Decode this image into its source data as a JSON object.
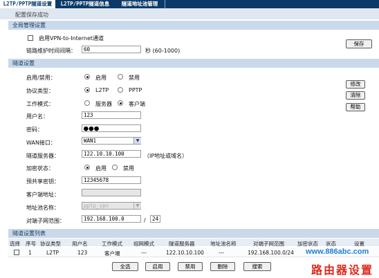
{
  "tabs": [
    "L2TP/PPTP隧道设置",
    "L2TP/PPTP隧道信息",
    "隧道地址池管理"
  ],
  "banner": "配置保存成功",
  "global": {
    "title": "全局管理设置",
    "enable_vpn_label": "启用VPN-to-Internet通道",
    "keepalive_label": "链路维护时间间隔：",
    "keepalive_value": "60",
    "keepalive_unit": "秒 (60-1000)",
    "save_label": "保存"
  },
  "tunnel": {
    "title": "隧道设置",
    "enable_label": "启用/禁用：",
    "opt_enable": "启用",
    "opt_disable": "禁用",
    "protocol_label": "协议类型：",
    "opt_l2tp": "L2TP",
    "opt_pptp": "PPTP",
    "mode_label": "工作模式：",
    "opt_server": "服务器",
    "opt_client": "客户端",
    "username_label": "用户名：",
    "username_value": "123",
    "password_label": "密码：",
    "password_value": "●●●",
    "wan_label": "WAN接口：",
    "wan_value": "WAN1",
    "server_label": "隧道服务器：",
    "server_value": "122.10.10.100",
    "server_hint": "（IP地址或域名）",
    "encrypt_label": "加密状态：",
    "opt_encrypt_on": "启用",
    "opt_encrypt_off": "禁用",
    "psk_label": "预共享密钥：",
    "psk_value": "12345678",
    "client_addr_label": "客户端地址：",
    "client_addr_value": "",
    "pool_label": "地址池名称：",
    "pool_value": "pptp_vpn",
    "peer_label": "对端子网范围：",
    "peer_ip": "192.168.100.0",
    "peer_sep": "/",
    "peer_mask": "24",
    "modify_label": "修改",
    "clear_label": "清除",
    "help_label": "帮助"
  },
  "list": {
    "title": "隧道设置列表",
    "headers": [
      "选择",
      "序号",
      "协议类型",
      "用户名",
      "工作模式",
      "组网模式",
      "隧道服务器",
      "地址池名称",
      "对端子网范围",
      "加密状态",
      "状态",
      "设置"
    ],
    "row": [
      "",
      "1",
      "L2TP",
      "123",
      "客户端",
      "---",
      "122.10.10.100",
      "---",
      "192.168.100.0/24",
      "",
      "",
      ""
    ]
  },
  "buttons": [
    "全选",
    "启用",
    "禁用",
    "删除",
    "搜索"
  ],
  "watermark": {
    "url": "www.886abc.com",
    "brand": "路由器设置"
  }
}
